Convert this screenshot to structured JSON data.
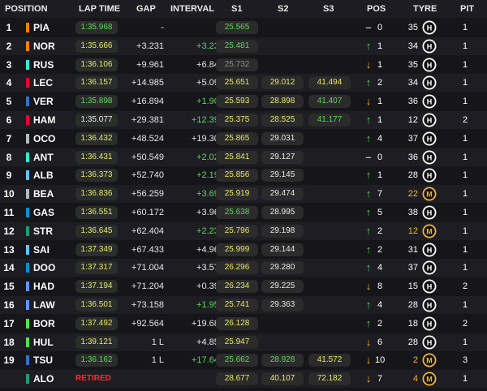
{
  "headers": {
    "position": "POSITION",
    "lap_time": "LAP TIME",
    "gap": "GAP",
    "interval": "INTERVAL",
    "s1": "S1",
    "s2": "S2",
    "s3": "S3",
    "pos": "POS",
    "tyre": "TYRE",
    "pit": "PIT"
  },
  "colors": {
    "green": "#5fd35f",
    "yellow": "#e6e66b",
    "orange": "#f2b632",
    "red": "#ff2a2a"
  },
  "rows": [
    {
      "pos": "1",
      "driver": "PIA",
      "team_color": "#ff8000",
      "lap_time": "1:35.968",
      "lap_class": "pb",
      "gap": "-",
      "gap_class": "w",
      "interval": "-",
      "int_class": "w",
      "s1": "25.565",
      "s1_class": "g",
      "s2": "",
      "s2_class": "w",
      "s3": "",
      "s3_class": "w",
      "arrow": "–",
      "arrow_dir": "flat",
      "pos_change": "0",
      "tyre_laps": "35",
      "tyre_compound": "H",
      "pit": "1"
    },
    {
      "pos": "2",
      "driver": "NOR",
      "team_color": "#ff8000",
      "lap_time": "1:35.666",
      "lap_class": "y",
      "gap": "+3.231",
      "gap_class": "w",
      "interval": "+3.231",
      "int_class": "g",
      "s1": "25.481",
      "s1_class": "g",
      "s2": "",
      "s2_class": "w",
      "s3": "",
      "s3_class": "w",
      "arrow": "↑",
      "arrow_dir": "up",
      "pos_change": "1",
      "tyre_laps": "34",
      "tyre_compound": "H",
      "pit": "1"
    },
    {
      "pos": "3",
      "driver": "RUS",
      "team_color": "#27f4d2",
      "lap_time": "1:36.106",
      "lap_class": "y",
      "gap": "+9.961",
      "gap_class": "w",
      "interval": "+6.842",
      "int_class": "w",
      "s1": "25.732",
      "s1_class": "dim",
      "s2": "",
      "s2_class": "w",
      "s3": "",
      "s3_class": "w",
      "arrow": "↓",
      "arrow_dir": "down",
      "pos_change": "1",
      "tyre_laps": "35",
      "tyre_compound": "H",
      "pit": "1"
    },
    {
      "pos": "4",
      "driver": "LEC",
      "team_color": "#e8002d",
      "lap_time": "1:36.157",
      "lap_class": "y",
      "gap": "+14.985",
      "gap_class": "w",
      "interval": "+5.097",
      "int_class": "w",
      "s1": "25.651",
      "s1_class": "y",
      "s2": "29.012",
      "s2_class": "y",
      "s3": "41.494",
      "s3_class": "y",
      "arrow": "↑",
      "arrow_dir": "up",
      "pos_change": "2",
      "tyre_laps": "34",
      "tyre_compound": "H",
      "pit": "1"
    },
    {
      "pos": "5",
      "driver": "VER",
      "team_color": "#3671c6",
      "lap_time": "1:35.898",
      "lap_class": "pb",
      "gap": "+16.894",
      "gap_class": "w",
      "interval": "+1.909",
      "int_class": "g",
      "s1": "25.593",
      "s1_class": "y",
      "s2": "28.898",
      "s2_class": "y",
      "s3": "41.407",
      "s3_class": "g",
      "arrow": "↓",
      "arrow_dir": "down",
      "pos_change": "1",
      "tyre_laps": "36",
      "tyre_compound": "H",
      "pit": "1"
    },
    {
      "pos": "6",
      "driver": "HAM",
      "team_color": "#e8002d",
      "lap_time": "1:35.077",
      "lap_class": "plain",
      "gap": "+29.381",
      "gap_class": "w",
      "interval": "+12.394",
      "int_class": "g",
      "s1": "25.375",
      "s1_class": "y",
      "s2": "28.525",
      "s2_class": "y",
      "s3": "41.177",
      "s3_class": "g",
      "arrow": "↑",
      "arrow_dir": "up",
      "pos_change": "1",
      "tyre_laps": "12",
      "tyre_compound": "H",
      "pit": "2"
    },
    {
      "pos": "7",
      "driver": "OCO",
      "team_color": "#b6babd",
      "lap_time": "1:36.432",
      "lap_class": "y",
      "gap": "+48.524",
      "gap_class": "w",
      "interval": "+19.305",
      "int_class": "w",
      "s1": "25.865",
      "s1_class": "y",
      "s2": "29.031",
      "s2_class": "w",
      "s3": "",
      "s3_class": "w",
      "arrow": "↑",
      "arrow_dir": "up",
      "pos_change": "4",
      "tyre_laps": "37",
      "tyre_compound": "H",
      "pit": "1"
    },
    {
      "pos": "8",
      "driver": "ANT",
      "team_color": "#27f4d2",
      "lap_time": "1:36.431",
      "lap_class": "y",
      "gap": "+50.549",
      "gap_class": "w",
      "interval": "+2.025",
      "int_class": "g",
      "s1": "25.841",
      "s1_class": "y",
      "s2": "29.127",
      "s2_class": "w",
      "s3": "",
      "s3_class": "w",
      "arrow": "–",
      "arrow_dir": "flat",
      "pos_change": "0",
      "tyre_laps": "36",
      "tyre_compound": "H",
      "pit": "1"
    },
    {
      "pos": "9",
      "driver": "ALB",
      "team_color": "#64c4ff",
      "lap_time": "1:36.373",
      "lap_class": "y",
      "gap": "+52.740",
      "gap_class": "w",
      "interval": "+2.191",
      "int_class": "g",
      "s1": "25.856",
      "s1_class": "y",
      "s2": "29.145",
      "s2_class": "w",
      "s3": "",
      "s3_class": "w",
      "arrow": "↑",
      "arrow_dir": "up",
      "pos_change": "1",
      "tyre_laps": "28",
      "tyre_compound": "H",
      "pit": "1"
    },
    {
      "pos": "10",
      "driver": "BEA",
      "team_color": "#b6babd",
      "lap_time": "1:36.836",
      "lap_class": "y",
      "gap": "+56.259",
      "gap_class": "w",
      "interval": "+3.693",
      "int_class": "g",
      "s1": "25.919",
      "s1_class": "y",
      "s2": "29.474",
      "s2_class": "w",
      "s3": "",
      "s3_class": "w",
      "arrow": "↑",
      "arrow_dir": "up",
      "pos_change": "7",
      "tyre_laps": "22",
      "tyre_compound": "M",
      "pit": "1"
    },
    {
      "pos": "11",
      "driver": "GAS",
      "team_color": "#0093cc",
      "lap_time": "1:36.551",
      "lap_class": "y",
      "gap": "+60.172",
      "gap_class": "w",
      "interval": "+3.968",
      "int_class": "w",
      "s1": "25.638",
      "s1_class": "g",
      "s2": "28.995",
      "s2_class": "w",
      "s3": "",
      "s3_class": "w",
      "arrow": "↑",
      "arrow_dir": "up",
      "pos_change": "5",
      "tyre_laps": "38",
      "tyre_compound": "H",
      "pit": "1"
    },
    {
      "pos": "12",
      "driver": "STR",
      "team_color": "#229971",
      "lap_time": "1:36.645",
      "lap_class": "y",
      "gap": "+62.404",
      "gap_class": "w",
      "interval": "+2.232",
      "int_class": "g",
      "s1": "25.796",
      "s1_class": "y",
      "s2": "29.198",
      "s2_class": "w",
      "s3": "",
      "s3_class": "w",
      "arrow": "↑",
      "arrow_dir": "up",
      "pos_change": "2",
      "tyre_laps": "12",
      "tyre_compound": "M",
      "pit": "1"
    },
    {
      "pos": "13",
      "driver": "SAI",
      "team_color": "#64c4ff",
      "lap_time": "1:37.349",
      "lap_class": "y",
      "gap": "+67.433",
      "gap_class": "w",
      "interval": "+4.961",
      "int_class": "w",
      "s1": "25.999",
      "s1_class": "y",
      "s2": "29.144",
      "s2_class": "w",
      "s3": "",
      "s3_class": "w",
      "arrow": "↑",
      "arrow_dir": "up",
      "pos_change": "2",
      "tyre_laps": "31",
      "tyre_compound": "H",
      "pit": "1"
    },
    {
      "pos": "14",
      "driver": "DOO",
      "team_color": "#0093cc",
      "lap_time": "1:37.317",
      "lap_class": "y",
      "gap": "+71.004",
      "gap_class": "w",
      "interval": "+3.571",
      "int_class": "w",
      "s1": "26.296",
      "s1_class": "y",
      "s2": "29.280",
      "s2_class": "w",
      "s3": "",
      "s3_class": "w",
      "arrow": "↑",
      "arrow_dir": "up",
      "pos_change": "4",
      "tyre_laps": "37",
      "tyre_compound": "H",
      "pit": "1"
    },
    {
      "pos": "15",
      "driver": "HAD",
      "team_color": "#6692ff",
      "lap_time": "1:37.194",
      "lap_class": "y",
      "gap": "+71.204",
      "gap_class": "w",
      "interval": "+0.394",
      "int_class": "w",
      "s1": "26.234",
      "s1_class": "y",
      "s2": "29.225",
      "s2_class": "w",
      "s3": "",
      "s3_class": "w",
      "arrow": "↓",
      "arrow_dir": "down",
      "pos_change": "8",
      "tyre_laps": "15",
      "tyre_compound": "H",
      "pit": "2"
    },
    {
      "pos": "16",
      "driver": "LAW",
      "team_color": "#6692ff",
      "lap_time": "1:36.501",
      "lap_class": "y",
      "gap": "+73.158",
      "gap_class": "w",
      "interval": "+1.954",
      "int_class": "g",
      "s1": "25.741",
      "s1_class": "y",
      "s2": "29.363",
      "s2_class": "w",
      "s3": "",
      "s3_class": "w",
      "arrow": "↑",
      "arrow_dir": "up",
      "pos_change": "4",
      "tyre_laps": "28",
      "tyre_compound": "H",
      "pit": "1"
    },
    {
      "pos": "17",
      "driver": "BOR",
      "team_color": "#52e252",
      "lap_time": "1:37.492",
      "lap_class": "y",
      "gap": "+92.564",
      "gap_class": "w",
      "interval": "+19.689",
      "int_class": "w",
      "s1": "26.128",
      "s1_class": "y",
      "s2": "",
      "s2_class": "w",
      "s3": "",
      "s3_class": "w",
      "arrow": "↑",
      "arrow_dir": "up",
      "pos_change": "2",
      "tyre_laps": "18",
      "tyre_compound": "H",
      "pit": "2"
    },
    {
      "pos": "18",
      "driver": "HUL",
      "team_color": "#52e252",
      "lap_time": "1:39.121",
      "lap_class": "y",
      "gap": "1 L",
      "gap_class": "w",
      "interval": "+4.858",
      "int_class": "w",
      "s1": "25.947",
      "s1_class": "y",
      "s2": "",
      "s2_class": "w",
      "s3": "",
      "s3_class": "w",
      "arrow": "↓",
      "arrow_dir": "down",
      "pos_change": "6",
      "tyre_laps": "28",
      "tyre_compound": "H",
      "pit": "1"
    },
    {
      "pos": "19",
      "driver": "TSU",
      "team_color": "#3671c6",
      "lap_time": "1:36.162",
      "lap_class": "pb",
      "gap": "1 L",
      "gap_class": "w",
      "interval": "+17.645",
      "int_class": "g",
      "s1": "25.662",
      "s1_class": "g",
      "s2": "28.928",
      "s2_class": "g",
      "s3": "41.572",
      "s3_class": "y",
      "arrow": "↓",
      "arrow_dir": "down",
      "pos_change": "10",
      "tyre_laps": "2",
      "tyre_compound": "M",
      "pit": "3"
    },
    {
      "pos": "",
      "driver": "ALO",
      "team_color": "#229971",
      "lap_time": "RETIRED",
      "lap_class": "ret",
      "gap": "",
      "gap_class": "w",
      "interval": "",
      "int_class": "w",
      "s1": "28.677",
      "s1_class": "y",
      "s2": "40.107",
      "s2_class": "y",
      "s3": "72.182",
      "s3_class": "y",
      "arrow": "↓",
      "arrow_dir": "down",
      "pos_change": "7",
      "tyre_laps": "4",
      "tyre_compound": "M",
      "pit": "1"
    }
  ]
}
